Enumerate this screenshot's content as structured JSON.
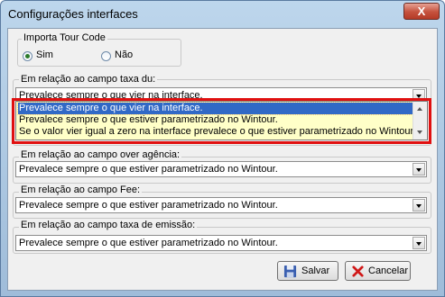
{
  "window": {
    "title": "Configurações interfaces",
    "close_symbol": "X"
  },
  "tour_code": {
    "label": "Importa Tour Code",
    "options": [
      {
        "label": "Sim",
        "selected": true
      },
      {
        "label": "Não",
        "selected": false
      }
    ]
  },
  "taxa_du": {
    "label": "Em relação ao campo taxa du:",
    "value": "Prevalece sempre o que vier na interface.",
    "dropdown_open": true,
    "options": [
      "Prevalece sempre o que vier na interface.",
      "Prevalece sempre o que estiver parametrizado no Wintour.",
      "Se o valor vier igual a zero na interface prevalece o que estiver parametrizado no Wintour."
    ],
    "highlight_color": "#e01010"
  },
  "over_agencia": {
    "label": "Em relação ao campo over agência:",
    "value": "Prevalece sempre o que estiver parametrizado no Wintour."
  },
  "fee": {
    "label": "Em relação ao campo Fee:",
    "value": "Prevalece sempre o que estiver parametrizado no Wintour."
  },
  "taxa_emissao": {
    "label": "Em relação ao campo taxa de emissão:",
    "value": "Prevalece sempre o que estiver parametrizado no Wintour."
  },
  "buttons": {
    "save": "Salvar",
    "cancel": "Cancelar"
  }
}
